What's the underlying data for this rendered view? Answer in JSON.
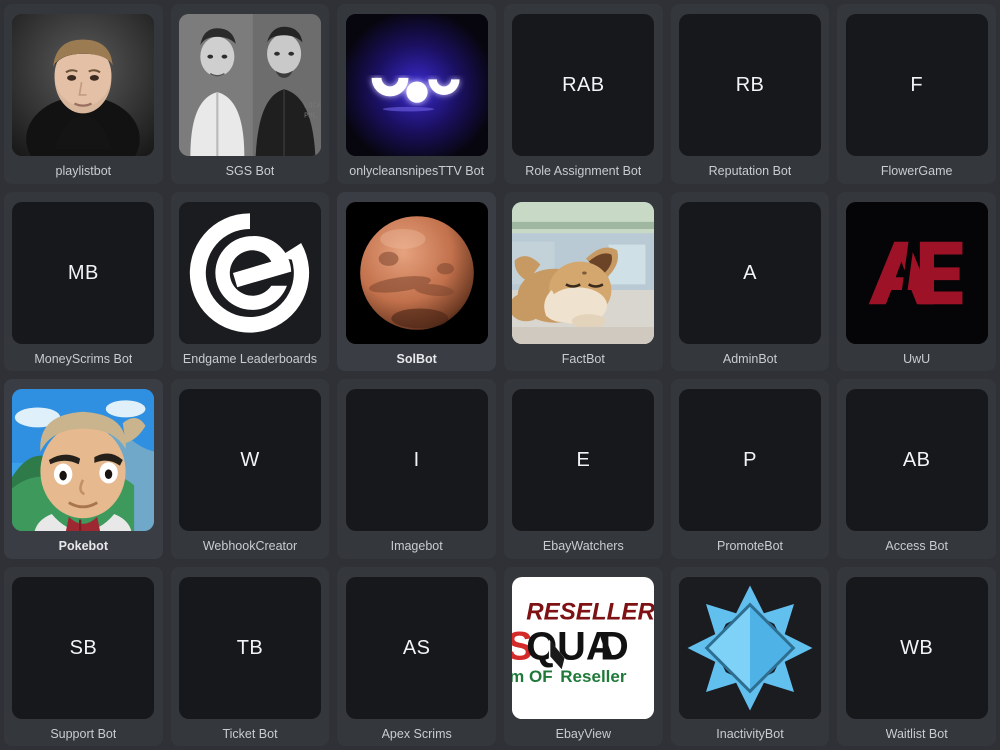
{
  "theme": {
    "page_background": "#2f3136",
    "card_background": "#34373c",
    "avatar_placeholder_background": "#17181c",
    "label_color": "#c9ccd1",
    "selected_label_color": "#ffffff"
  },
  "grid": {
    "columns": 6,
    "rows": 4,
    "items": [
      {
        "name": "playlistbot",
        "avatar_type": "photo",
        "initials": "",
        "icon": "portrait-young-man-photo",
        "selected": false
      },
      {
        "name": "SGS Bot",
        "avatar_type": "photo",
        "initials": "",
        "icon": "duo-portrait-bw-photo",
        "selected": false
      },
      {
        "name": "onlycleansnipesTTV Bot",
        "avatar_type": "artwork",
        "initials": "",
        "icon": "glowing-eyes-logo",
        "selected": false
      },
      {
        "name": "Role Assignment Bot",
        "avatar_type": "initials",
        "initials": "RAB",
        "icon": "initials-avatar",
        "selected": false
      },
      {
        "name": "Reputation Bot",
        "avatar_type": "initials",
        "initials": "RB",
        "icon": "initials-avatar",
        "selected": false
      },
      {
        "name": "FlowerGame",
        "avatar_type": "initials",
        "initials": "F",
        "icon": "initials-avatar",
        "selected": false
      },
      {
        "name": "MoneyScrims Bot",
        "avatar_type": "initials",
        "initials": "MB",
        "icon": "initials-avatar",
        "selected": false
      },
      {
        "name": "Endgame Leaderboards",
        "avatar_type": "artwork",
        "initials": "",
        "icon": "endgame-e-logo",
        "selected": false
      },
      {
        "name": "SolBot",
        "avatar_type": "photo",
        "initials": "",
        "icon": "mars-planet-photo",
        "selected": true
      },
      {
        "name": "FactBot",
        "avatar_type": "photo",
        "initials": "",
        "icon": "eevee-anime-photo",
        "selected": false
      },
      {
        "name": "AdminBot",
        "avatar_type": "initials",
        "initials": "A",
        "icon": "initials-avatar",
        "selected": false
      },
      {
        "name": "UwU",
        "avatar_type": "artwork",
        "initials": "",
        "icon": "ae-monogram-logo",
        "selected": false
      },
      {
        "name": "Pokebot",
        "avatar_type": "photo",
        "initials": "",
        "icon": "professor-oak-photo",
        "selected": true
      },
      {
        "name": "WebhookCreator",
        "avatar_type": "initials",
        "initials": "W",
        "icon": "initials-avatar",
        "selected": false
      },
      {
        "name": "Imagebot",
        "avatar_type": "initials",
        "initials": "I",
        "icon": "initials-avatar",
        "selected": false
      },
      {
        "name": "EbayWatchers",
        "avatar_type": "initials",
        "initials": "E",
        "icon": "initials-avatar",
        "selected": false
      },
      {
        "name": "PromoteBot",
        "avatar_type": "initials",
        "initials": "P",
        "icon": "initials-avatar",
        "selected": false
      },
      {
        "name": "Access Bot",
        "avatar_type": "initials",
        "initials": "AB",
        "icon": "initials-avatar",
        "selected": false
      },
      {
        "name": "Support Bot",
        "avatar_type": "initials",
        "initials": "SB",
        "icon": "initials-avatar",
        "selected": false
      },
      {
        "name": "Ticket Bot",
        "avatar_type": "initials",
        "initials": "TB",
        "icon": "initials-avatar",
        "selected": false
      },
      {
        "name": "Apex Scrims",
        "avatar_type": "initials",
        "initials": "AS",
        "icon": "initials-avatar",
        "selected": false
      },
      {
        "name": "EbayView",
        "avatar_type": "artwork",
        "initials": "",
        "icon": "resellers-squad-logo",
        "selected": false
      },
      {
        "name": "InactivityBot",
        "avatar_type": "artwork",
        "initials": "",
        "icon": "blue-diamond-star-logo",
        "selected": false
      },
      {
        "name": "Waitlist Bot",
        "avatar_type": "initials",
        "initials": "WB",
        "icon": "initials-avatar",
        "selected": false
      }
    ]
  }
}
